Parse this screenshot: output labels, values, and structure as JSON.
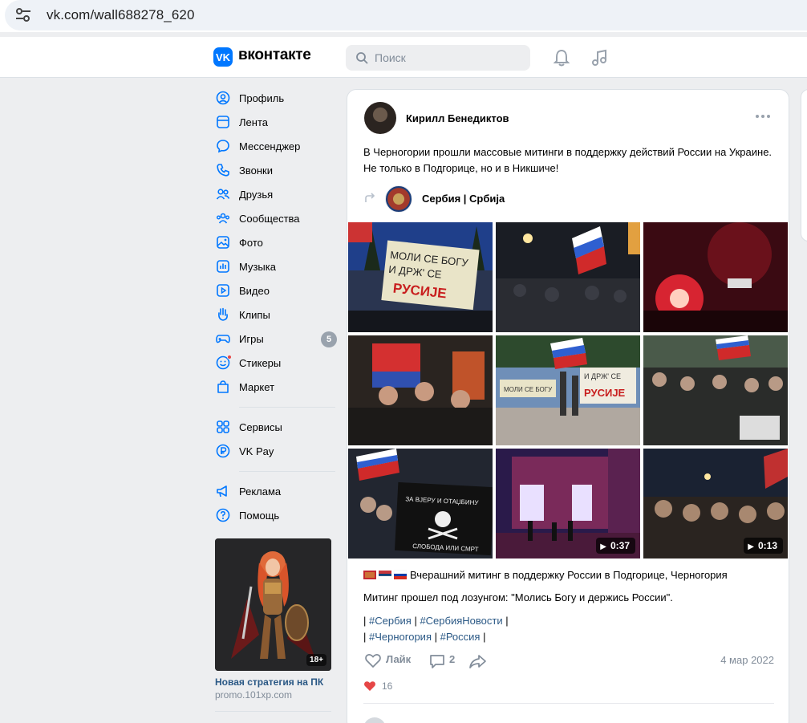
{
  "browser": {
    "url": "vk.com/wall688278_620"
  },
  "header": {
    "brand": "вконтакте",
    "logo_text": "VK",
    "search_placeholder": "Поиск"
  },
  "sidebar": {
    "items": [
      {
        "label": "Профиль",
        "icon": "user-icon"
      },
      {
        "label": "Лента",
        "icon": "feed-icon"
      },
      {
        "label": "Мессенджер",
        "icon": "message-icon"
      },
      {
        "label": "Звонки",
        "icon": "phone-icon"
      },
      {
        "label": "Друзья",
        "icon": "friends-icon"
      },
      {
        "label": "Сообщества",
        "icon": "communities-icon"
      },
      {
        "label": "Фото",
        "icon": "photo-icon"
      },
      {
        "label": "Музыка",
        "icon": "music-icon"
      },
      {
        "label": "Видео",
        "icon": "video-icon"
      },
      {
        "label": "Клипы",
        "icon": "clips-icon"
      },
      {
        "label": "Игры",
        "icon": "games-icon",
        "badge": "5"
      },
      {
        "label": "Стикеры",
        "icon": "stickers-icon"
      },
      {
        "label": "Маркет",
        "icon": "market-icon"
      }
    ],
    "items2": [
      {
        "label": "Сервисы",
        "icon": "services-icon"
      },
      {
        "label": "VK Pay",
        "icon": "vkpay-icon"
      }
    ],
    "items3": [
      {
        "label": "Реклама",
        "icon": "ads-icon"
      },
      {
        "label": "Помощь",
        "icon": "help-icon"
      }
    ],
    "ad": {
      "title": "Новая стратегия на ПК",
      "domain": "promo.101xp.com",
      "age": "18+"
    }
  },
  "post": {
    "author": "Кирилл Бенедиктов",
    "text": "В Черногории прошли массовые митинги в поддержку действий России на Украине. Не только в Подгорице, но и в Никшиче!",
    "repost_source": "Сербия | Србија",
    "photos": [
      {
        "kind": "photo",
        "banner_text": "МОЛИ СЕ БОГУ И ДРЖ' СЕ РУСИЈЕ"
      },
      {
        "kind": "photo"
      },
      {
        "kind": "photo"
      },
      {
        "kind": "photo"
      },
      {
        "kind": "photo",
        "banner_text": "МОЛИ СЕ БОГУ И ДРЖ' СЕ РУСИЈЕ"
      },
      {
        "kind": "photo"
      },
      {
        "kind": "photo",
        "banner_text": "ЗА ВЈЕРУ И ОТАЏБИНУ СЛОБОДА ИЛИ СМРТ"
      },
      {
        "kind": "video",
        "duration": "0:37"
      },
      {
        "kind": "video",
        "duration": "0:13"
      }
    ],
    "caption": "Вчерашний митинг в поддержку России в Подгорице, Черногория",
    "caption2": "Митинг прошел под лозунгом: \"Молись Богу и держись России\".",
    "tags_line1": [
      "#Сербия",
      "#СербияНовости"
    ],
    "tags_line2": [
      "#Черногория",
      "#Россия"
    ],
    "like_label": "Лайк",
    "comments": "2",
    "date": "4 мар 2022",
    "reactions": "16"
  },
  "colors": {
    "accent": "#0077ff",
    "link": "#2a5885",
    "muted": "#818c99",
    "heart": "#e64646"
  }
}
